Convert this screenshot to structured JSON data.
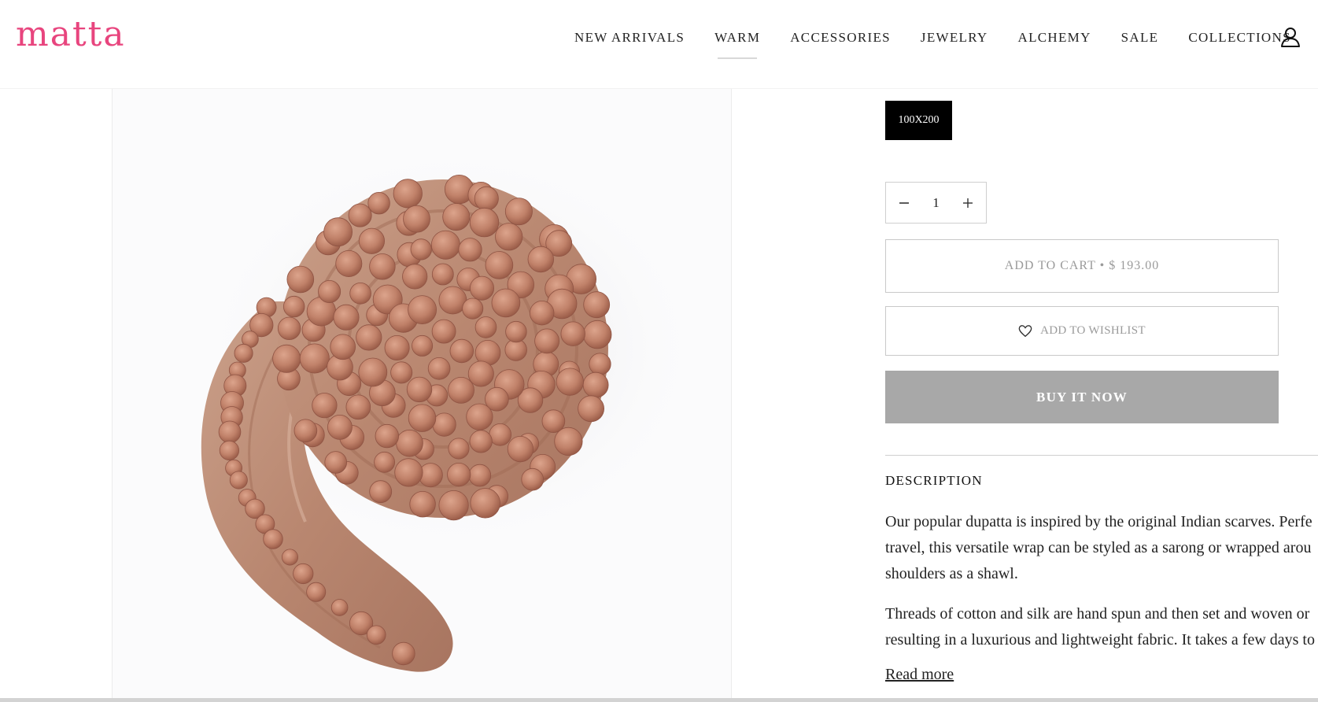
{
  "brand": {
    "logo": "matta",
    "color": "#e8457e"
  },
  "nav": {
    "items": [
      {
        "label": "NEW ARRIVALS"
      },
      {
        "label": "WARM",
        "active": true
      },
      {
        "label": "ACCESSORIES"
      },
      {
        "label": "JEWELRY"
      },
      {
        "label": "ALCHEMY"
      },
      {
        "label": "SALE"
      },
      {
        "label": "COLLECTIONS"
      }
    ],
    "account_icon": "user-account-icon"
  },
  "product": {
    "image": "pom-pom-dupatta-scarf-image",
    "size_option": "100X200",
    "quantity": "1",
    "qty_minus_icon": "minus-icon",
    "qty_plus_icon": "plus-icon",
    "add_to_cart": "ADD TO CART • $ 193.00",
    "add_to_wishlist": "ADD TO WISHLIST",
    "wishlist_icon": "heart-icon",
    "buy_now": "BUY IT NOW"
  },
  "description": {
    "heading": "DESCRIPTION",
    "paragraph1": [
      "Our popular dupatta is inspired by the original Indian scarves. Perfe",
      "travel, this versatile wrap can be styled as a sarong or wrapped arou",
      "shoulders as a shawl."
    ],
    "paragraph2": [
      "Threads of cotton and silk are hand spun and then set and woven or",
      "resulting in a luxurious and lightweight fabric. It takes a few days to"
    ],
    "read_more": "Read more"
  },
  "colors": {
    "buy_button": "#a8a8a8",
    "selected_size_bg": "#000000",
    "scarf": "#c28a72"
  }
}
